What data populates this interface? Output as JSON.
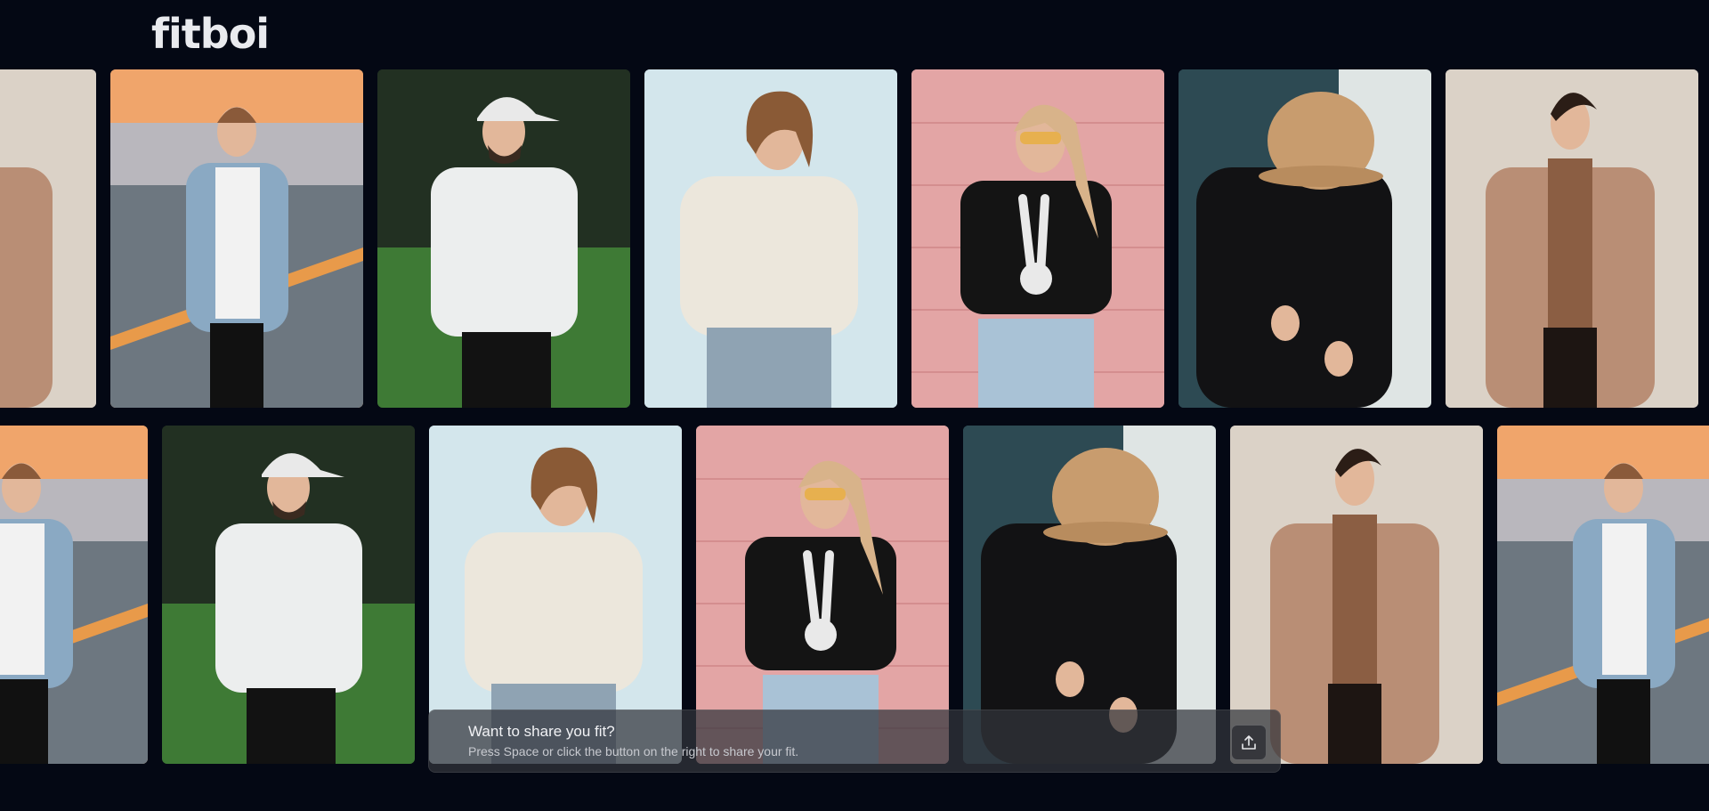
{
  "app": {
    "logo": "fitboi"
  },
  "gallery": {
    "row1": [
      {
        "theme": "coat-man",
        "bg": "#d9d0c6"
      },
      {
        "theme": "denim-jacket-man",
        "bg": "#e7a874"
      },
      {
        "theme": "white-tee-cap-man",
        "bg": "#2a3a2c"
      },
      {
        "theme": "cream-sweater-woman",
        "bg": "#cfe3ea"
      },
      {
        "theme": "skeleton-tee-woman",
        "bg": "#e2a7a6"
      },
      {
        "theme": "bucket-hat-black-man",
        "bg": "#3f5d66"
      },
      {
        "theme": "coat-man",
        "bg": "#d9d0c6"
      }
    ],
    "row2": [
      {
        "theme": "denim-jacket-man",
        "bg": "#e7a874"
      },
      {
        "theme": "white-tee-cap-man",
        "bg": "#2a3a2c"
      },
      {
        "theme": "cream-sweater-woman",
        "bg": "#cfe3ea"
      },
      {
        "theme": "skeleton-tee-woman",
        "bg": "#e2a7a6"
      },
      {
        "theme": "bucket-hat-black-man",
        "bg": "#3f5d66"
      },
      {
        "theme": "coat-man",
        "bg": "#d9d0c6"
      },
      {
        "theme": "denim-jacket-man",
        "bg": "#e7a874"
      }
    ]
  },
  "share": {
    "title": "Want to share you fit?",
    "subtitle": "Press Space or click the button on the right to share your fit.",
    "button_icon": "upload-icon"
  },
  "colors": {
    "background": "#040814",
    "logo": "#e9eaee"
  }
}
